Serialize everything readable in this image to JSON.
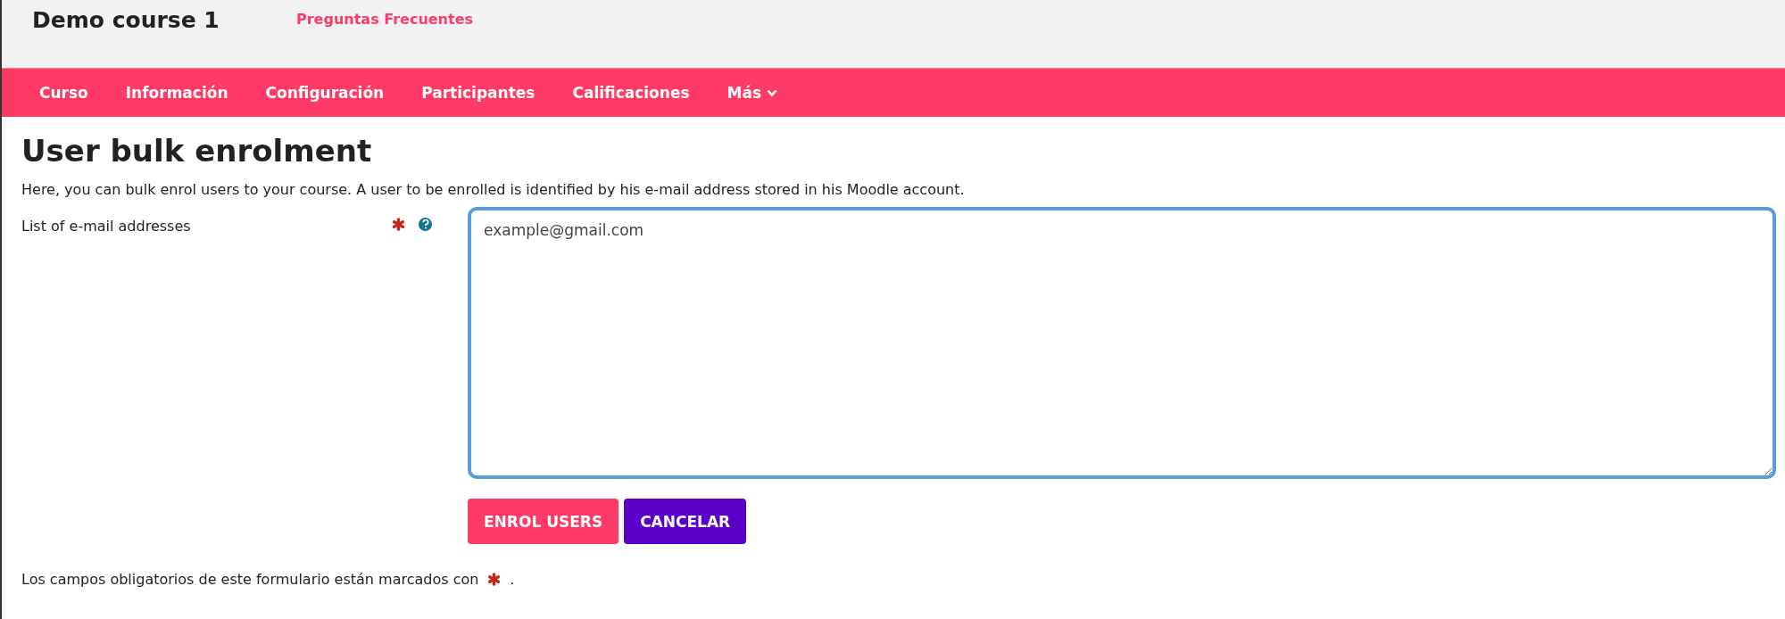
{
  "header": {
    "course_title": "Demo course 1",
    "link": "Preguntas Frecuentes"
  },
  "nav": {
    "items": [
      {
        "label": "Curso",
        "kind": "link"
      },
      {
        "label": "Información",
        "kind": "link"
      },
      {
        "label": "Configuración",
        "kind": "link"
      },
      {
        "label": "Participantes",
        "kind": "link"
      },
      {
        "label": "Calificaciones",
        "kind": "link"
      },
      {
        "label": "Más",
        "kind": "dropdown"
      }
    ]
  },
  "page": {
    "title": "User bulk enrolment",
    "description": "Here, you can bulk enrol users to your course. A user to be enrolled is identified by his e-mail address stored in his Moodle account."
  },
  "form": {
    "field": {
      "label": "List of e-mail addresses",
      "required": true,
      "help": true,
      "value": "example@gmail.com"
    },
    "buttons": [
      {
        "label": "ENROL USERS",
        "kind": "primary"
      },
      {
        "label": "CANCELAR",
        "kind": "secondary"
      }
    ],
    "required_note": {
      "before": "Los campos obligatorios de este formulario están marcados con",
      "after": "."
    }
  }
}
